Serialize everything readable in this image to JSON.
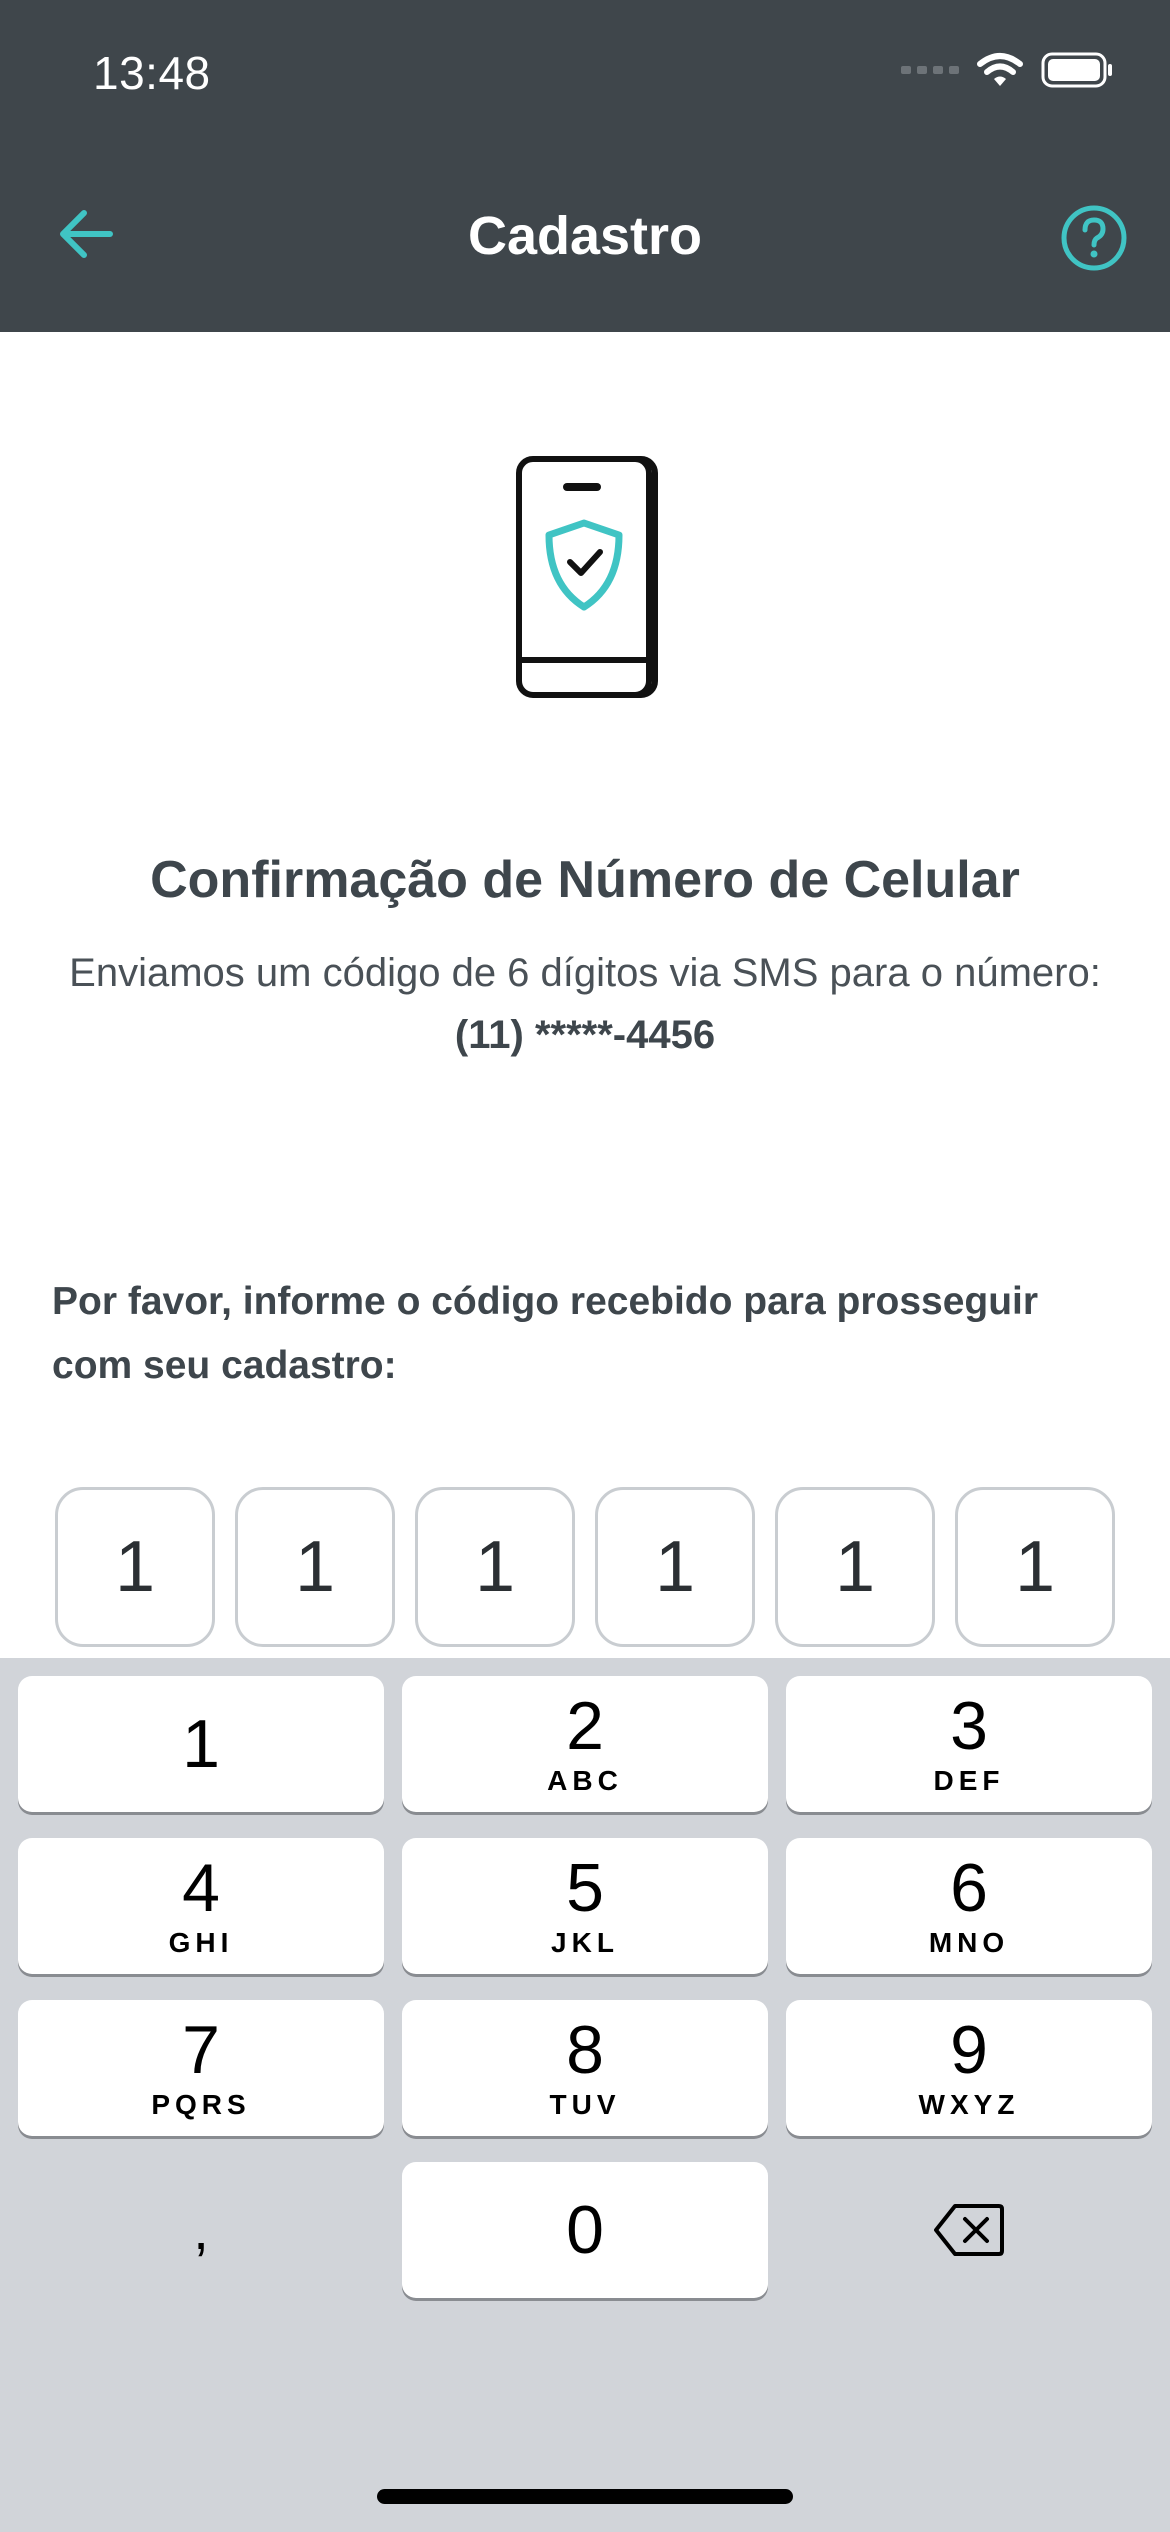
{
  "status_bar": {
    "time": "13:48"
  },
  "header": {
    "title": "Cadastro",
    "back_icon": "arrow-left-icon",
    "help_icon": "question-circle-icon",
    "accent_color": "#40c4c4",
    "background": "#3f464b"
  },
  "illustration": {
    "icon": "phone-shield-check-icon"
  },
  "main": {
    "heading": "Confirmação de Número de Celular",
    "subtext_prefix": "Enviamos um código de 6 dígitos via SMS para o número: ",
    "phone_masked": "(11) *****-4456",
    "instruction": "Por favor, informe o código recebido para prosseguir com seu cadastro:"
  },
  "code": {
    "digits": [
      "1",
      "1",
      "1",
      "1",
      "1",
      "1"
    ]
  },
  "keyboard": {
    "keys": [
      {
        "num": "1",
        "letters": ""
      },
      {
        "num": "2",
        "letters": "ABC"
      },
      {
        "num": "3",
        "letters": "DEF"
      },
      {
        "num": "4",
        "letters": "GHI"
      },
      {
        "num": "5",
        "letters": "JKL"
      },
      {
        "num": "6",
        "letters": "MNO"
      },
      {
        "num": "7",
        "letters": "PQRS"
      },
      {
        "num": "8",
        "letters": "TUV"
      },
      {
        "num": "9",
        "letters": "WXYZ"
      },
      {
        "num": ",",
        "letters": ""
      },
      {
        "num": "0",
        "letters": ""
      }
    ],
    "delete_icon": "backspace-icon"
  }
}
